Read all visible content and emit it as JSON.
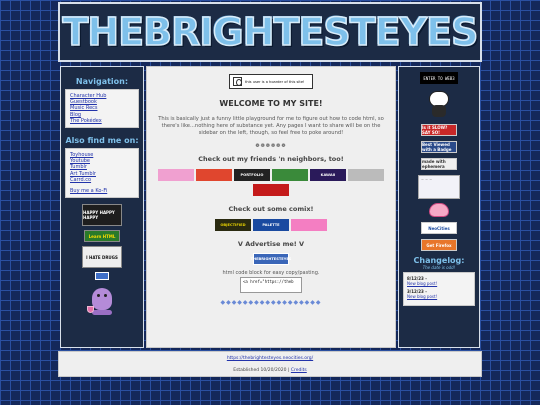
{
  "header": {
    "title": "THEBRIGHTESTEYES"
  },
  "left_sidebar": {
    "nav_heading": "Navigation:",
    "nav_links": [
      "Character Hub",
      "Guestbook",
      "Music Recs",
      "Blog",
      "The Pokédex"
    ],
    "also_heading": "Also find me on:",
    "social_links": [
      "Toyhouse",
      "Youtube",
      "Tumblr",
      "Art Tumblr",
      "Carrd.co"
    ],
    "kofi_link": "Buy me a Ko-Fi",
    "buttons": [
      {
        "name": "happy-eyes-badge",
        "label": "HAPPY HAPPY HAPPY"
      },
      {
        "name": "learn-html-badge",
        "label": "Learn HTML"
      },
      {
        "name": "hate-drugs-badge",
        "label": "I HATE DRUGS"
      }
    ]
  },
  "main": {
    "top_badge": "this user is a hoarder of this site!",
    "welcome": "WELCOME TO MY SITE!",
    "intro": "This is basically just a funny little playground for me to figure out how to code html, so there's like...nothing here of substance yet. Any pages I want to share will be on the sidebar on the left, though, so feel free to poke around!",
    "dots": "❁❁❁❁❁❁",
    "friends_heading": "Check out my friends 'n neighbors, too!",
    "friends": [
      "friend1",
      "friend2",
      "PORTFOLIO",
      "friend4",
      "KAWAII",
      "friend6",
      "friend7"
    ],
    "comics_heading": "Check out some comix!",
    "comics": [
      "OBJECTIFIED",
      "PALETTE",
      "comic3"
    ],
    "advertise_heading": "V Advertise me! V",
    "advertise_button": "THEBRIGHTESTEYES",
    "code_label": "html code block for easy copy/pasting.",
    "code_text": "<a href=\"https://theb",
    "gems": "◆◆◆◆◆◆◆◆◆◆◆◆◆◆◆◆◆◆"
  },
  "right_sidebar": {
    "top_button": "ENTER TO WEB3",
    "buttons": [
      "Is it SLOW? SAY SO!",
      "Best Viewed with a Badge",
      "made with ephemera",
      "NeoCities",
      "Get Firefox"
    ],
    "changelog_heading": "Changelog:",
    "changelog_sub": "The date is odd!",
    "entries": [
      {
        "date": "8/12/23 -",
        "link": "New blog post!"
      },
      {
        "date": "3/12/23 -",
        "link": "New blog post!"
      }
    ]
  },
  "footer": {
    "url": "https://thebrightesteyes.neocities.org/",
    "established": "Established 10/20/2020 | ",
    "credits": "Credits"
  }
}
